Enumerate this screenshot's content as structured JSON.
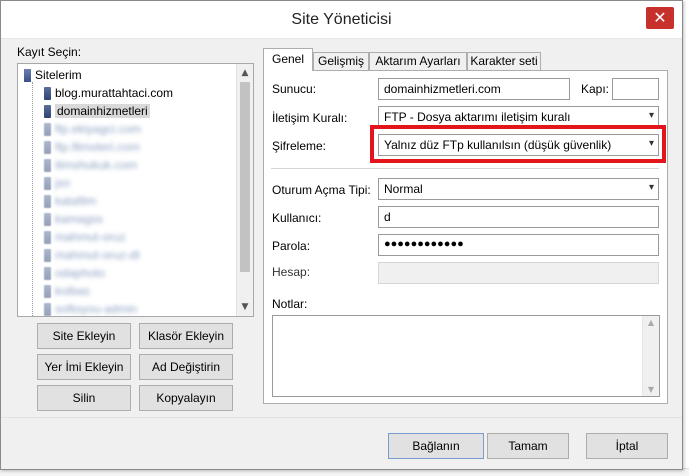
{
  "window": {
    "title": "Site Yöneticisi",
    "close_glyph": "✕"
  },
  "left": {
    "label": "Kayıt Seçin:",
    "tree": {
      "root": "Sitelerim",
      "items": [
        {
          "label": "blog.murattahtaci.com",
          "selected": false,
          "blurred": false
        },
        {
          "label": "domainhizmetleri",
          "selected": true,
          "blurred": false
        },
        {
          "label": "ftp.ekiyagci.com",
          "blurred": true
        },
        {
          "label": "ftp.filmoteri.com",
          "blurred": true
        },
        {
          "label": "ilimshukuk.com",
          "blurred": true
        },
        {
          "label": "jsn",
          "blurred": true
        },
        {
          "label": "katafilm",
          "blurred": true
        },
        {
          "label": "kamagss",
          "blurred": true
        },
        {
          "label": "mahmut-oruz",
          "blurred": true
        },
        {
          "label": "mahmut-oruz-dt",
          "blurred": true
        },
        {
          "label": "odaphoto",
          "blurred": true
        },
        {
          "label": "kolbas",
          "blurred": true
        },
        {
          "label": "softoyou-admin",
          "blurred": true
        }
      ]
    },
    "buttons": {
      "add_site": "Site Ekleyin",
      "add_folder": "Klasör Ekleyin",
      "add_bookmark": "Yer İmi Ekleyin",
      "rename": "Ad Değiştirin",
      "delete": "Silin",
      "copy": "Kopyalayın"
    }
  },
  "tabs": [
    {
      "label": "Genel",
      "active": true
    },
    {
      "label": "Gelişmiş",
      "active": false
    },
    {
      "label": "Aktarım Ayarları",
      "active": false
    },
    {
      "label": "Karakter seti",
      "active": false
    }
  ],
  "form": {
    "host_label": "Sunucu:",
    "host_value": "domainhizmetleri.com",
    "port_label": "Kapı:",
    "port_value": "",
    "protocol_label": "İletişim Kuralı:",
    "protocol_value": "FTP - Dosya aktarımı iletişim kuralı",
    "encryption_label": "Şifreleme:",
    "encryption_value": "Yalnız düz FTp kullanılsın (düşük güvenlik)",
    "logon_label": "Oturum Açma Tipi:",
    "logon_value": "Normal",
    "user_label": "Kullanıcı:",
    "user_value": "d",
    "password_label": "Parola:",
    "password_value": "●●●●●●●●●●●●",
    "account_label": "Hesap:",
    "account_value": "",
    "notes_label": "Notlar:"
  },
  "footer": {
    "connect": "Bağlanın",
    "ok": "Tamam",
    "cancel": "İptal"
  },
  "colors": {
    "highlight": "#e3151a",
    "close": "#c7312b"
  }
}
